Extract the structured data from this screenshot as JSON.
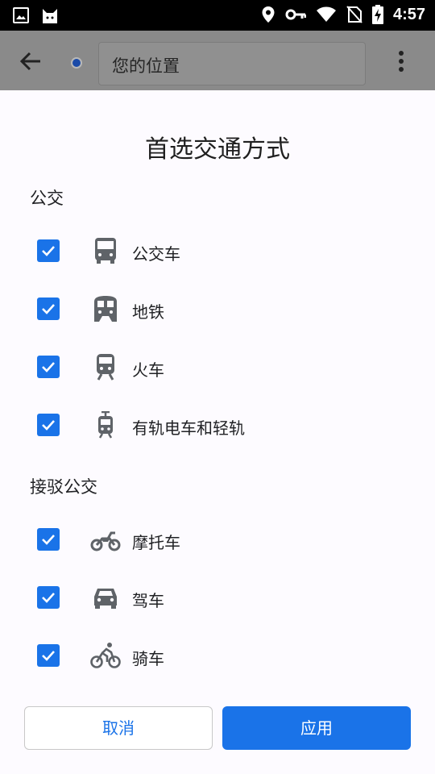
{
  "status_bar": {
    "time": "4:57"
  },
  "app_bar": {
    "search_value": "您的位置"
  },
  "sheet": {
    "title": "首选交通方式",
    "transit_section": "公交",
    "transit_options": [
      {
        "label": "公交车",
        "icon": "bus-icon",
        "checked": true
      },
      {
        "label": "地铁",
        "icon": "subway-icon",
        "checked": true
      },
      {
        "label": "火车",
        "icon": "train-icon",
        "checked": true
      },
      {
        "label": "有轨电车和轻轨",
        "icon": "tram-icon",
        "checked": true
      }
    ],
    "connect_section": "接驳公交",
    "connect_options": [
      {
        "label": "摩托车",
        "icon": "motorcycle-icon",
        "checked": true
      },
      {
        "label": "驾车",
        "icon": "car-icon",
        "checked": true
      },
      {
        "label": "骑车",
        "icon": "bike-icon",
        "checked": true
      }
    ],
    "cancel_label": "取消",
    "apply_label": "应用"
  },
  "colors": {
    "accent": "#1a73e8",
    "scrim": "#7a7a7a",
    "sheet_bg": "#fdfbff"
  }
}
